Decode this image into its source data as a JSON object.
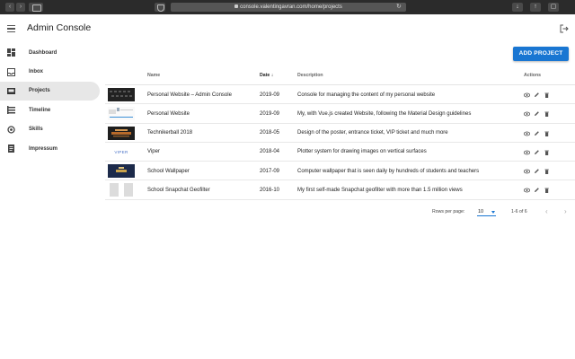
{
  "browser": {
    "url": "console.valentingavran.com/home/projects"
  },
  "app": {
    "title": "Admin Console",
    "accent": "#1976d2"
  },
  "sidebar": {
    "items": [
      {
        "label": "Dashboard",
        "icon": "dashboard-icon"
      },
      {
        "label": "Inbox",
        "icon": "inbox-icon"
      },
      {
        "label": "Projects",
        "icon": "projects-icon",
        "active": true
      },
      {
        "label": "Timeline",
        "icon": "timeline-icon"
      },
      {
        "label": "Skills",
        "icon": "skills-icon"
      },
      {
        "label": "Impressum",
        "icon": "impressum-icon"
      }
    ]
  },
  "toolbar": {
    "add_label": "ADD PROJECT"
  },
  "table": {
    "headers": {
      "name": "Name",
      "date": "Date",
      "description": "Description",
      "actions": "Actions"
    },
    "sort_arrow": "↓",
    "rows": [
      {
        "name": "Personal Website – Admin Console",
        "date": "2019-09",
        "description": "Console for managing the content of my personal website"
      },
      {
        "name": "Personal Website",
        "date": "2019-09",
        "description": "My, with Vue.js created Website, following the Material Design guidelines"
      },
      {
        "name": "Technikerball 2018",
        "date": "2018-05",
        "description": "Design of the poster, entrance ticket, VIP ticket and much more"
      },
      {
        "name": "Viper",
        "date": "2018-04",
        "description": "Plotter system for drawing images on vertical surfaces",
        "thumb_text": "VIPER"
      },
      {
        "name": "School Wallpaper",
        "date": "2017-09",
        "description": "Computer wallpaper that is seen daily by hundreds of students and teachers"
      },
      {
        "name": "School Snapchat Geofilter",
        "date": "2016-10",
        "description": "My first self-made Snapchat geofilter with more than 1.5 million views"
      }
    ]
  },
  "pagination": {
    "rows_per_page_label": "Rows per page:",
    "rows_per_page_value": "10",
    "range": "1-6 of 6"
  }
}
